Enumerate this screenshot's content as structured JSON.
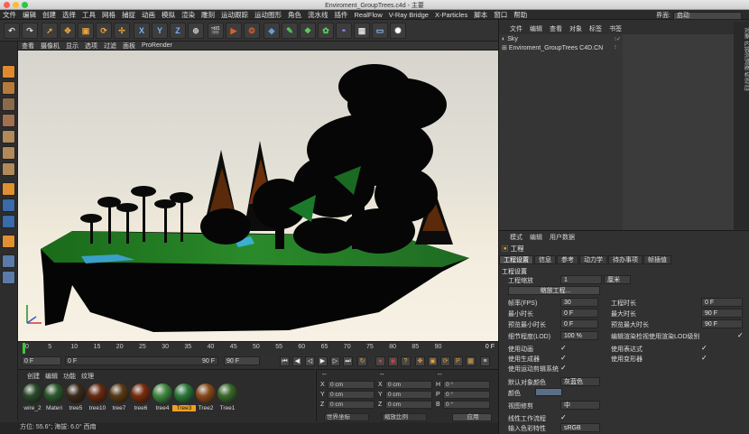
{
  "window": {
    "title": "Enviroment_GroupTrees.c4d - 主要"
  },
  "menu": [
    "文件",
    "编辑",
    "创建",
    "选择",
    "工具",
    "网格",
    "捕捉",
    "动画",
    "模拟",
    "渲染",
    "雕刻",
    "运动跟踪",
    "运动图形",
    "角色",
    "流水线",
    "插件",
    "RealFlow",
    "V-Ray Bridge",
    "X-Particles",
    "脚本",
    "窗口",
    "帮助"
  ],
  "interface": {
    "label": "界面:",
    "value": "启动"
  },
  "toolbar": {
    "x": "X",
    "y": "Y",
    "z": "Z"
  },
  "viewport_menu": [
    "查看",
    "摄像机",
    "显示",
    "选项",
    "过滤",
    "面板",
    "ProRender"
  ],
  "timeline": {
    "ticks": [
      "0",
      "5",
      "10",
      "15",
      "20",
      "25",
      "30",
      "35",
      "40",
      "45",
      "50",
      "55",
      "60",
      "65",
      "70",
      "75",
      "80",
      "85",
      "90"
    ],
    "end": "0 F"
  },
  "controls": {
    "start": "0 F",
    "mid": "0 F",
    "end": "90 F",
    "end2": "90 F"
  },
  "materials": {
    "menu": [
      "创建",
      "编辑",
      "功能",
      "纹理"
    ],
    "items": [
      {
        "name": "wire_2",
        "color": "#2a4a2a"
      },
      {
        "name": "Materi",
        "color": "#2c5a2c"
      },
      {
        "name": "tree5",
        "color": "#3a2a18"
      },
      {
        "name": "tree10",
        "color": "#6a2a10"
      },
      {
        "name": "tree7",
        "color": "#5a3a14"
      },
      {
        "name": "tree6",
        "color": "#7a2c0c"
      },
      {
        "name": "tree4",
        "color": "#3f8a3f"
      },
      {
        "name": "Tree3",
        "color": "#2a7a3a",
        "selected": true
      },
      {
        "name": "Tree2",
        "color": "#8a4a1a"
      },
      {
        "name": "Tree1",
        "color": "#3a6a2a"
      }
    ]
  },
  "coords": {
    "header1": "--",
    "header2": "--",
    "header3": "--",
    "rows": [
      {
        "a": "X",
        "av": "0 cm",
        "b": "X",
        "bv": "0 cm",
        "c": "H",
        "cv": "0 °"
      },
      {
        "a": "Y",
        "av": "0 cm",
        "b": "Y",
        "bv": "0 cm",
        "c": "P",
        "cv": "0 °"
      },
      {
        "a": "Z",
        "av": "0 cm",
        "b": "Z",
        "bv": "0 cm",
        "c": "B",
        "cv": "0 °"
      }
    ],
    "world": "世界坐标",
    "scale": "缩放比例",
    "apply": "应用"
  },
  "status": "方位: 55.6°; 海拔: 6.0° 西南",
  "objects": {
    "menu": [
      "文件",
      "编辑",
      "查看",
      "对象",
      "标签",
      "书签"
    ],
    "items": [
      "Sky",
      "Enviroment_GroupTrees C4D.CN"
    ]
  },
  "sidetabs": "对象 内容浏览器 构造 层",
  "attributes": {
    "menu": [
      "模式",
      "编辑",
      "用户数据"
    ],
    "title": "工程",
    "tabs": [
      "工程设置",
      "信息",
      "参考",
      "动力学",
      "待办事项",
      "帧插值"
    ],
    "section": "工程设置",
    "scale_label": "工程缩放",
    "scale_value": "1",
    "scale_unit": "厘米",
    "scale_button": "缩放工程...",
    "fps_label": "帧率(FPS)",
    "fps": "30",
    "project_time_label": "工程时长",
    "project_time": "0 F",
    "min_time_label": "最小时长",
    "min_time": "0 F",
    "max_time_label": "最大时长",
    "max_time": "90 F",
    "pmin_label": "预览最小时长",
    "pmin": "0 F",
    "pmax_label": "预览最大时长",
    "pmax": "90 F",
    "lod_label": "细节程度(LOD)",
    "lod": "100 %",
    "lod_render_label": "编辑渲染检视使用渲染LOD级别",
    "use_anim": "使用动画",
    "use_expr": "使用表达式",
    "use_gen": "使用生成器",
    "use_deform": "使用变形器",
    "use_motion": "使用运动剪辑系统",
    "default_color_label": "默认对象颜色",
    "default_color": "灰蓝色",
    "color_label": "颜色",
    "view_clip_label": "视图修剪",
    "view_clip": "中",
    "linear_label": "线性工作流程",
    "input_color_label": "输入色彩特性",
    "input_color": "sRGB"
  },
  "colors": {
    "accent": "#f08a24",
    "select": "#f0a020",
    "panel": "#2f2f2f"
  }
}
